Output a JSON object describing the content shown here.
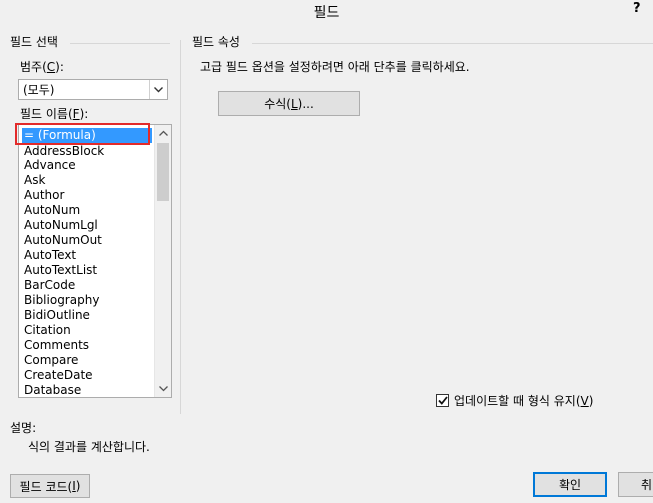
{
  "window": {
    "title": "필드",
    "help_label": "?"
  },
  "field_select": {
    "group_title": "필드 선택",
    "category_label_pre": "범주(",
    "category_label_key": "C",
    "category_label_post": "):",
    "category_value": "(모두)",
    "names_label_pre": "필드 이름(",
    "names_label_key": "F",
    "names_label_post": "):",
    "names": [
      "= (Formula)",
      "AddressBlock",
      "Advance",
      "Ask",
      "Author",
      "AutoNum",
      "AutoNumLgl",
      "AutoNumOut",
      "AutoText",
      "AutoTextList",
      "BarCode",
      "Bibliography",
      "BidiOutline",
      "Citation",
      "Comments",
      "Compare",
      "CreateDate",
      "Database"
    ],
    "selected_index": 0
  },
  "field_props": {
    "group_title": "필드 속성",
    "instruction": "고급 필드 옵션을 설정하려면 아래 단추를 클릭하세요.",
    "formula_button_pre": "수식(",
    "formula_button_key": "L",
    "formula_button_post": ")..."
  },
  "options": {
    "preserve_label_pre": "업데이트할 때 형식 유지(",
    "preserve_label_key": "V",
    "preserve_label_post": ")",
    "preserve_checked": true
  },
  "description": {
    "label": "설명:",
    "text": "식의 결과를 계산합니다."
  },
  "buttons": {
    "field_codes_pre": "필드 코드(",
    "field_codes_key": "I",
    "field_codes_post": ")",
    "ok": "확인",
    "cancel_partial": "취"
  }
}
